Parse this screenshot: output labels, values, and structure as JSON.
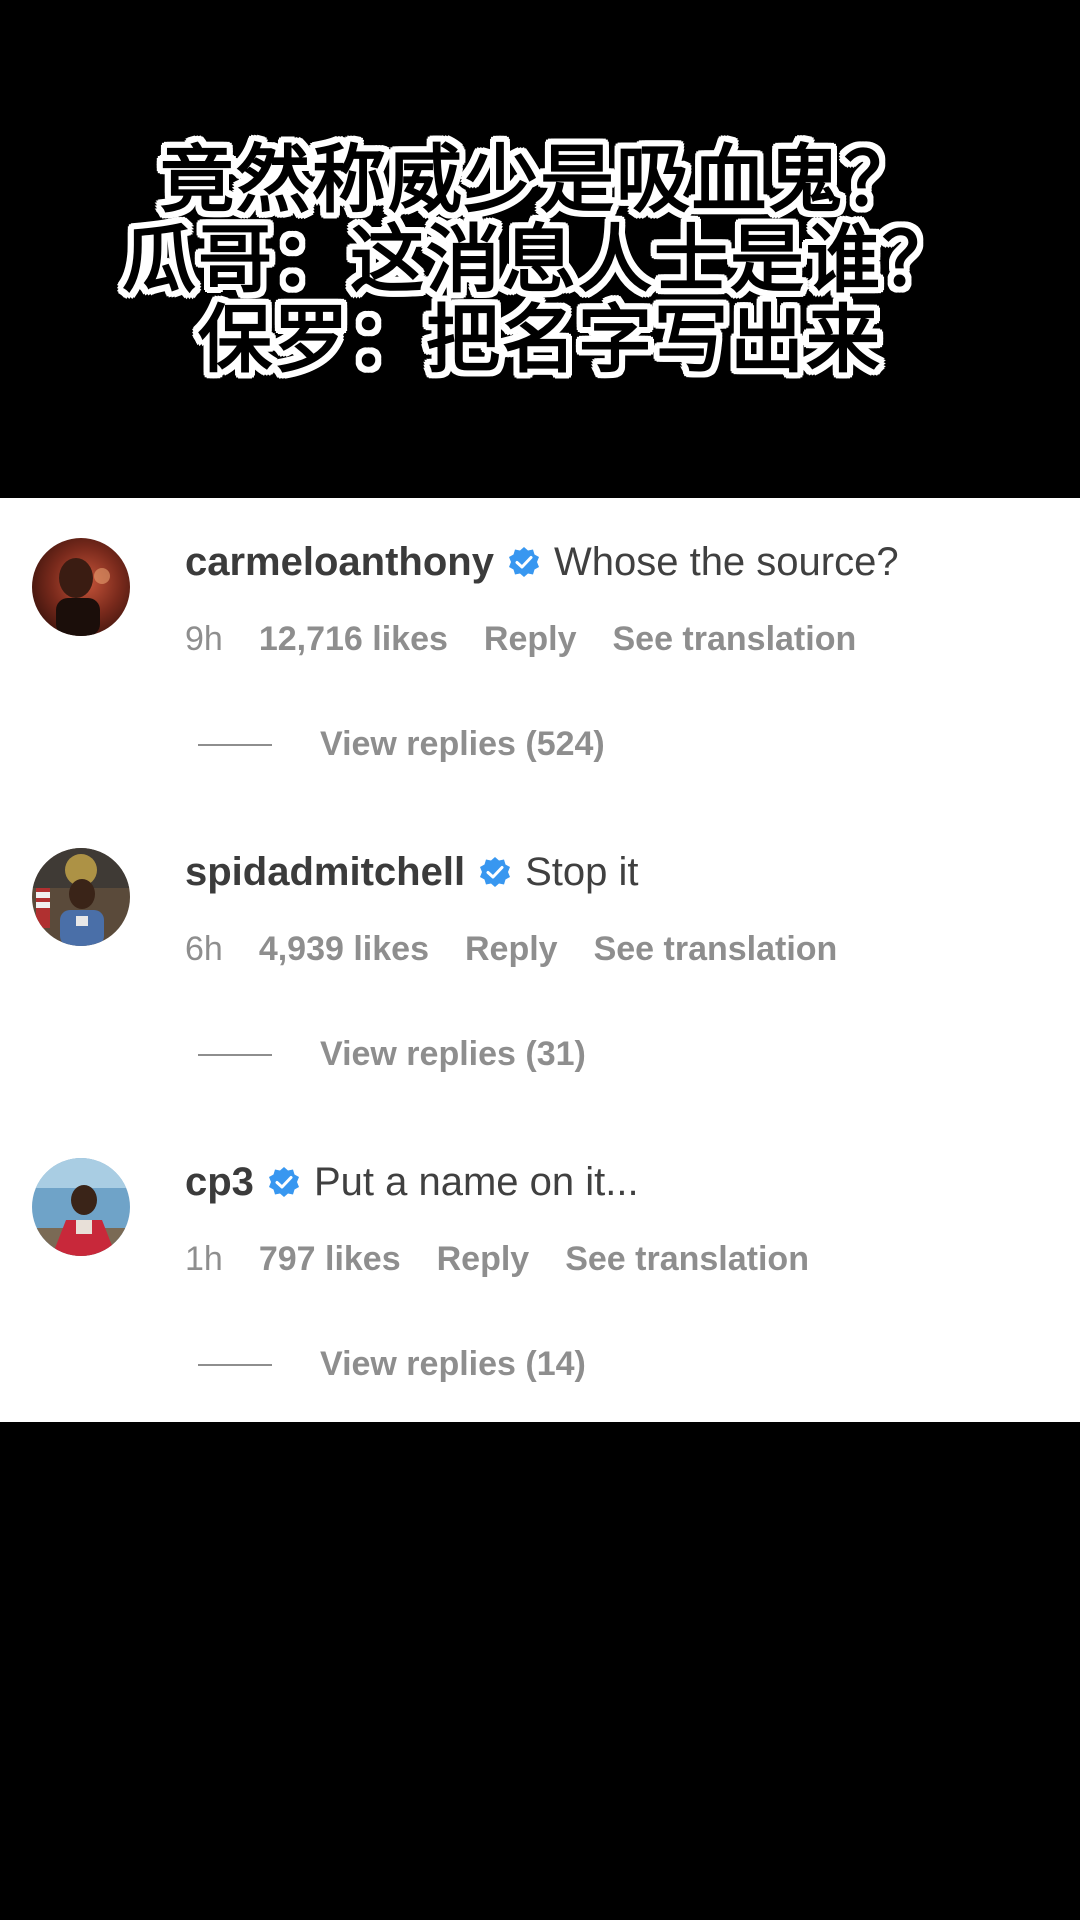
{
  "video_title": {
    "lines": [
      "竟然称威少是吸血鬼？",
      "瓜哥：这消息人士是谁？",
      "保罗：把名字写出来"
    ]
  },
  "comments": [
    {
      "username": "carmeloanthony",
      "verified": true,
      "text": "Whose the source?",
      "time": "9h",
      "likes": "12,716 likes",
      "reply_label": "Reply",
      "translate_label": "See translation",
      "view_replies": "View replies (524)",
      "avatar_icon": "avatar-photo-icon"
    },
    {
      "username": "spidadmitchell",
      "verified": true,
      "text": "Stop it",
      "time": "6h",
      "likes": "4,939 likes",
      "reply_label": "Reply",
      "translate_label": "See translation",
      "view_replies": "View replies (31)",
      "avatar_icon": "avatar-photo-icon"
    },
    {
      "username": "cp3",
      "verified": true,
      "text": "Put a name on it...",
      "time": "1h",
      "likes": "797 likes",
      "reply_label": "Reply",
      "translate_label": "See translation",
      "view_replies": "View replies (14)",
      "avatar_icon": "avatar-photo-icon"
    }
  ],
  "colors": {
    "background": "#000000",
    "panel": "#ffffff",
    "text_primary": "#262626",
    "text_secondary": "#8e8e8e",
    "verified_badge": "#3897f0"
  }
}
